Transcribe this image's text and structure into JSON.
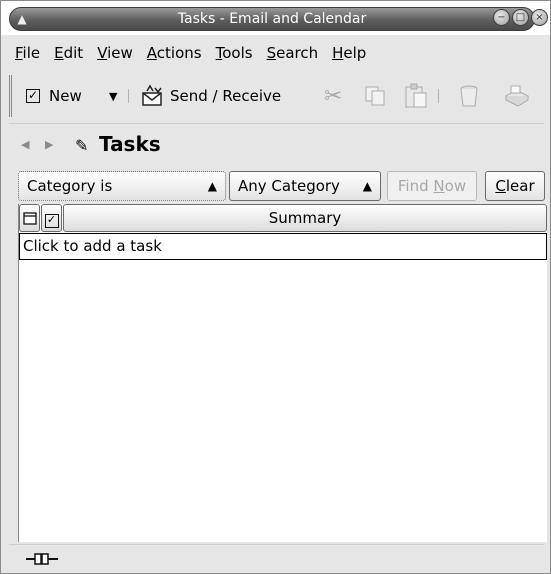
{
  "window": {
    "title": "Tasks - Email and Calendar"
  },
  "menubar": {
    "items": [
      {
        "key": "F",
        "rest": "ile"
      },
      {
        "key": "E",
        "rest": "dit"
      },
      {
        "key": "V",
        "rest": "iew"
      },
      {
        "key": "A",
        "rest": "ctions"
      },
      {
        "key": "T",
        "rest": "ools"
      },
      {
        "key": "S",
        "rest": "earch"
      },
      {
        "key": "H",
        "rest": "elp"
      }
    ]
  },
  "toolbar": {
    "new_label": "New",
    "send_receive_label": "Send / Receive"
  },
  "section": {
    "title": "Tasks"
  },
  "search": {
    "criterion": "Category is",
    "category": "Any Category",
    "find_now_pre": "Find ",
    "find_now_key": "N",
    "find_now_post": "ow",
    "clear_key": "C",
    "clear_rest": "lear"
  },
  "table": {
    "summary_header": "Summary",
    "add_task_text": "Click to add a task"
  },
  "icons": {
    "window_menu": "window-menu-icon",
    "new": "checkbox-icon",
    "send_receive": "send-receive-icon",
    "cut": "scissors-icon",
    "copy": "copy-icon",
    "paste": "paste-icon",
    "delete": "trash-icon",
    "print": "print-icon",
    "tasks": "tasks-icon",
    "online": "online-status-icon"
  }
}
